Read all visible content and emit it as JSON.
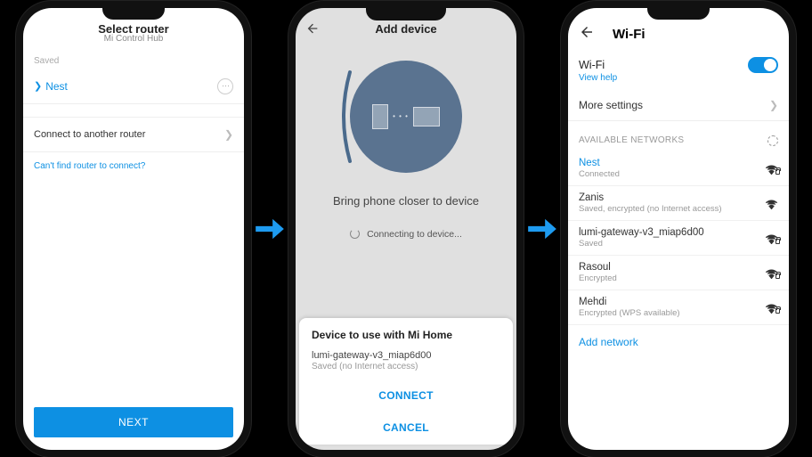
{
  "phone1": {
    "title": "Select router",
    "subtitle": "Mi Control Hub",
    "saved_label": "Saved",
    "nest_name": "Nest",
    "another_router": "Connect to another router",
    "help_link": "Can't find router to connect?",
    "next_button": "NEXT"
  },
  "phone2": {
    "title": "Add device",
    "message": "Bring phone closer to device",
    "status": "Connecting to device...",
    "sheet_title": "Device to use with Mi Home",
    "network_name": "lumi-gateway-v3_miap6d00",
    "network_sub": "Saved (no Internet access)",
    "connect": "CONNECT",
    "cancel": "CANCEL"
  },
  "phone3": {
    "title": "Wi-Fi",
    "wifi_label": "Wi-Fi",
    "view_help": "View help",
    "more_settings": "More settings",
    "available_label": "AVAILABLE NETWORKS",
    "networks": [
      {
        "name": "Nest",
        "sub": "Connected",
        "current": true,
        "lock": true
      },
      {
        "name": "Zanis",
        "sub": "Saved, encrypted (no Internet access)",
        "lock": false
      },
      {
        "name": "lumi-gateway-v3_miap6d00",
        "sub": "Saved",
        "lock": true
      },
      {
        "name": "Rasoul",
        "sub": "Encrypted",
        "lock": true
      },
      {
        "name": "Mehdi",
        "sub": "Encrypted (WPS available)",
        "lock": true
      }
    ],
    "add_network": "Add network"
  }
}
